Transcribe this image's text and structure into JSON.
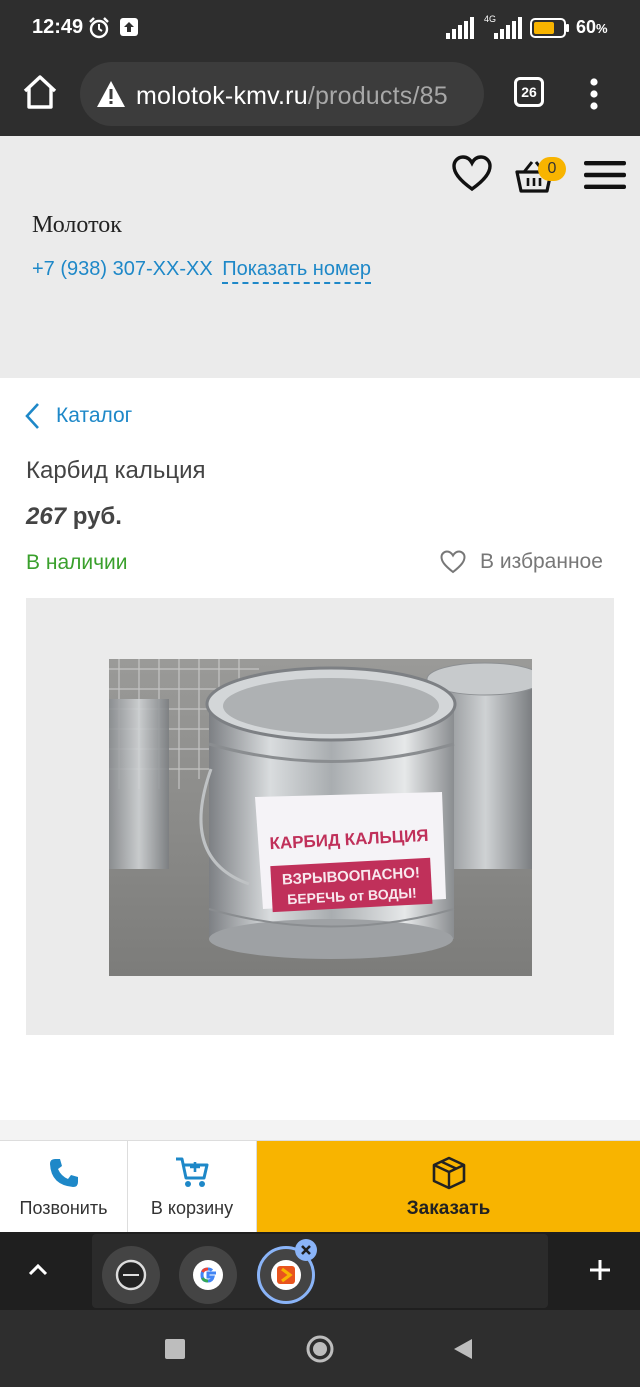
{
  "status_bar": {
    "time": "12:49",
    "network": "4G",
    "battery_percent": "60",
    "battery_unit": "%"
  },
  "browser": {
    "url_domain": "molotok-kmv.ru",
    "url_path": "/products/85",
    "tab_count": "26"
  },
  "site_header": {
    "cart_count": "0",
    "site_name": "Молоток",
    "phone": "+7 (938) 307-XX-XX",
    "show_number": "Показать номер"
  },
  "product": {
    "breadcrumb": "Каталог",
    "title": "Карбид кальция",
    "price_value": "267",
    "price_currency": "руб.",
    "availability": "В наличии",
    "favorite_label": "В избранное",
    "image": {
      "label_line1": "КАРБИД КАЛЬЦИЯ",
      "label_line2": "ВЗРЫВООПАСНО!",
      "label_line3": "БЕРЕЧЬ от ВОДЫ!"
    }
  },
  "actions": {
    "call": "Позвонить",
    "to_cart": "В корзину",
    "order": "Заказать"
  },
  "colors": {
    "accent": "#f8b400",
    "link": "#1e88c8",
    "in_stock": "#3aa02c"
  }
}
